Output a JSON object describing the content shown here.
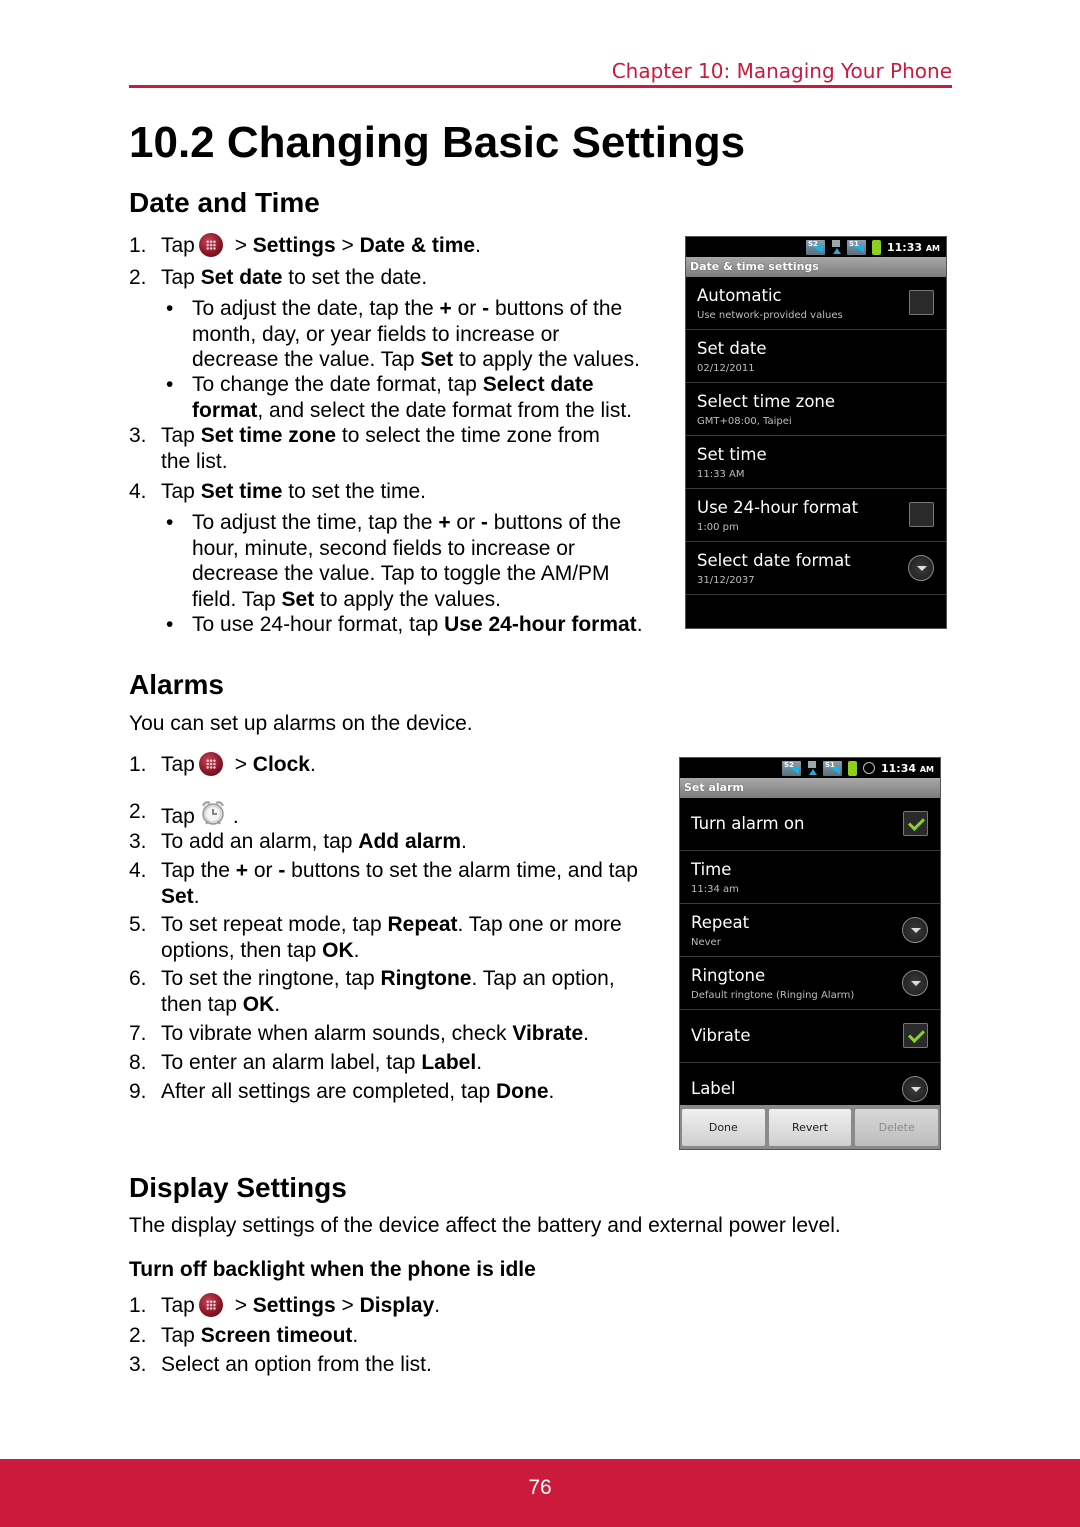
{
  "header": {
    "chapter": "Chapter 10: Managing Your Phone"
  },
  "page_title": "10.2 Changing Basic Settings",
  "date_time": {
    "heading": "Date and Time",
    "steps": [
      {
        "num": "1.",
        "pre": "Tap",
        "icon": "app-drawer-icon",
        "post_plain": " > ",
        "b1": "Settings",
        "mid": " > ",
        "b2": "Date & time",
        "end": "."
      },
      {
        "num": "2.",
        "pre": "Tap ",
        "b1": "Set date",
        "post": " to set the date."
      },
      {
        "num": "3.",
        "pre": "Tap ",
        "b1": "Set time zone",
        "post": " to select the time zone from the list."
      },
      {
        "num": "4.",
        "pre": "Tap ",
        "b1": "Set time",
        "post": " to set the time."
      }
    ],
    "bullets": [
      {
        "pre": "To adjust the date, tap the ",
        "b1": "+",
        "m1": " or ",
        "b2": "-",
        "m2": " buttons of the month, day, or year fields to increase or decrease the value. Tap ",
        "b3": "Set",
        "post": " to apply the values."
      },
      {
        "pre": "To change the date format, tap ",
        "b1": "Select date format",
        "post": ", and select the date format from the list."
      },
      {
        "pre": "To adjust the time, tap the ",
        "b1": "+",
        "m1": " or ",
        "b2": "-",
        "m2": " buttons of the hour, minute, second fields to increase or decrease the value. Tap to toggle the AM/PM field. Tap ",
        "b3": "Set",
        "post": " to apply the values."
      },
      {
        "pre": "To use 24-hour format, tap ",
        "b1": "Use 24-hour format",
        "post": "."
      }
    ],
    "screenshot": {
      "status_time": "11:33",
      "status_ampm": "AM",
      "title": "Date & time settings",
      "rows": [
        {
          "title": "Automatic",
          "sub": "Use network-provided values",
          "control": "checkbox",
          "checked": false
        },
        {
          "title": "Set date",
          "sub": "02/12/2011",
          "control": "none"
        },
        {
          "title": "Select time zone",
          "sub": "GMT+08:00, Taipei",
          "control": "none"
        },
        {
          "title": "Set time",
          "sub": "11:33 AM",
          "control": "none"
        },
        {
          "title": "Use 24-hour format",
          "sub": "1:00 pm",
          "control": "checkbox",
          "checked": false
        },
        {
          "title": "Select date format",
          "sub": "31/12/2037",
          "control": "dropdown"
        }
      ]
    }
  },
  "alarms": {
    "heading": "Alarms",
    "intro": "You can set up alarms on the device.",
    "steps": [
      {
        "num": "1.",
        "pre": "Tap",
        "b1": "Clock",
        "end": "."
      },
      {
        "num": "2.",
        "pre": "Tap",
        "end": "."
      },
      {
        "num": "3.",
        "pre": "To add an alarm, tap ",
        "b1": "Add alarm",
        "post": "."
      },
      {
        "num": "4.",
        "pre": "Tap the ",
        "b1": "+",
        "m1": " or ",
        "b2": "-",
        "m2": " buttons to set the alarm time, and tap ",
        "b3": "Set",
        "post": "."
      },
      {
        "num": "5.",
        "pre": "To set repeat mode, tap ",
        "b1": "Repeat",
        "m1": ". Tap one or more options, then tap ",
        "b2": "OK",
        "post": "."
      },
      {
        "num": "6.",
        "pre": "To set the ringtone, tap ",
        "b1": "Ringtone",
        "m1": ". Tap an option, then tap ",
        "b2": "OK",
        "post": "."
      },
      {
        "num": "7.",
        "pre": "To vibrate when alarm sounds, check ",
        "b1": "Vibrate",
        "post": "."
      },
      {
        "num": "8.",
        "pre": "To enter an alarm label, tap ",
        "b1": "Label",
        "post": "."
      },
      {
        "num": "9.",
        "pre": "After all settings are completed, tap ",
        "b1": "Done",
        "post": "."
      }
    ],
    "screenshot": {
      "status_time": "11:34",
      "status_ampm": "AM",
      "title": "Set alarm",
      "rows": [
        {
          "title": "Turn alarm on",
          "sub": "",
          "control": "checkbox",
          "checked": true
        },
        {
          "title": "Time",
          "sub": "11:34 am",
          "control": "none"
        },
        {
          "title": "Repeat",
          "sub": "Never",
          "control": "dropdown"
        },
        {
          "title": "Ringtone",
          "sub": "Default ringtone (Ringing Alarm)",
          "control": "dropdown"
        },
        {
          "title": "Vibrate",
          "sub": "",
          "control": "checkbox",
          "checked": true
        },
        {
          "title": "Label",
          "sub": "",
          "control": "dropdown"
        }
      ],
      "buttons": [
        "Done",
        "Revert",
        "Delete"
      ]
    }
  },
  "display": {
    "heading": "Display Settings",
    "intro": "The display settings of the device affect the battery and external power level.",
    "subheading": "Turn off backlight when the phone is idle",
    "steps": [
      {
        "num": "1.",
        "pre": "Tap",
        "b1": "Settings",
        "mid": " > ",
        "b2": "Display",
        "end": "."
      },
      {
        "num": "2.",
        "pre": "Tap ",
        "b1": "Screen timeout",
        "post": "."
      },
      {
        "num": "3.",
        "pre": "Select an option from the list."
      }
    ]
  },
  "footer": {
    "page_number": "76"
  }
}
